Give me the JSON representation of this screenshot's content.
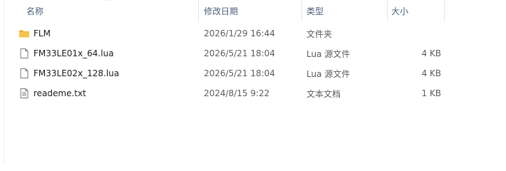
{
  "columns": {
    "name": "名称",
    "modified": "修改日期",
    "type": "类型",
    "size": "大小"
  },
  "sort": {
    "column": "name",
    "indicator": "^"
  },
  "files": [
    {
      "name": "FLM",
      "modified": "2026/1/29 16:44",
      "type": "文件夹",
      "size": "",
      "icon": "folder-icon"
    },
    {
      "name": "FM33LE01x_64.lua",
      "modified": "2026/5/21 18:04",
      "type": "Lua 源文件",
      "size": "4 KB",
      "icon": "lua-file-icon"
    },
    {
      "name": "FM33LE02x_128.lua",
      "modified": "2026/5/21 18:04",
      "type": "Lua 源文件",
      "size": "4 KB",
      "icon": "lua-file-icon"
    },
    {
      "name": "reademe.txt",
      "modified": "2024/8/15 9:22",
      "type": "文本文档",
      "size": "1 KB",
      "icon": "text-file-icon"
    }
  ],
  "colors": {
    "header_text": "#4c607a",
    "folder": "#f6c34f"
  }
}
